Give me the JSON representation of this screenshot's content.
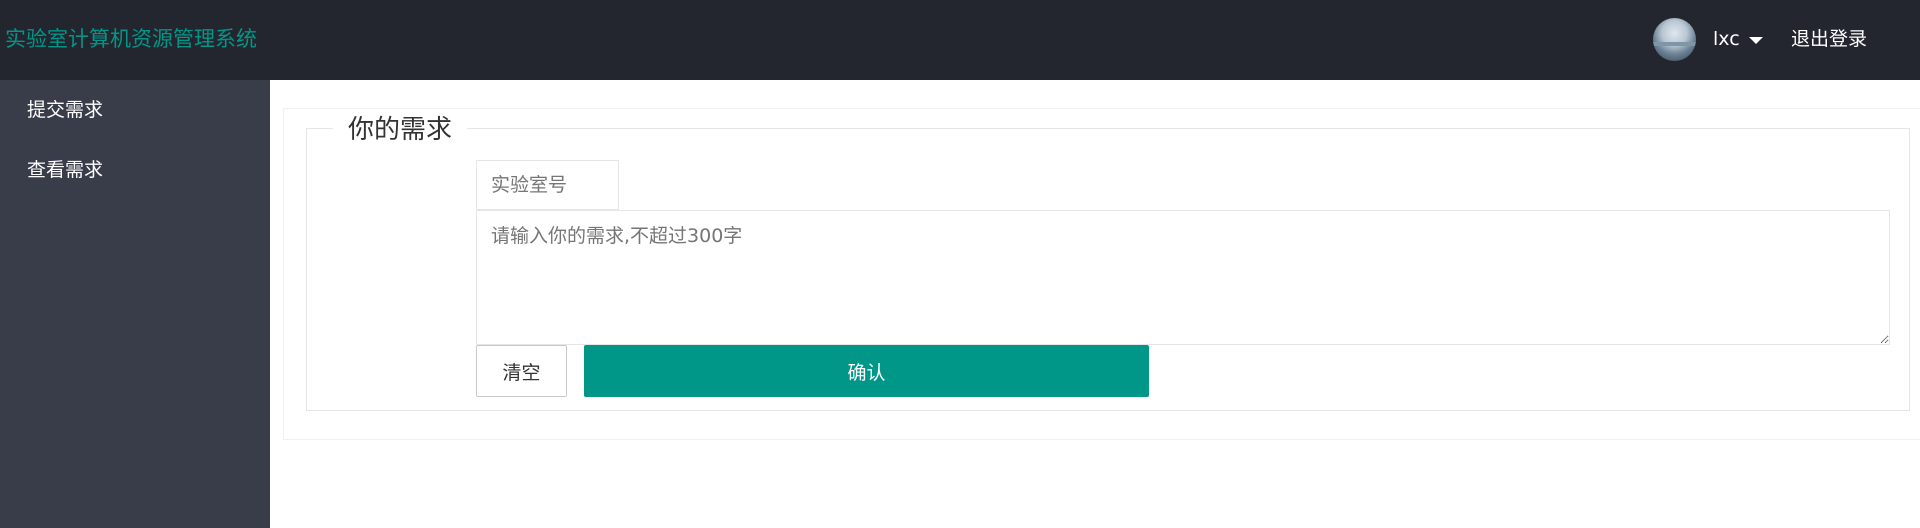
{
  "header": {
    "brand": "实验室计算机资源管理系统",
    "username": "lxc",
    "logout_label": "退出登录"
  },
  "sidebar": {
    "items": [
      {
        "label": "提交需求"
      },
      {
        "label": "查看需求"
      }
    ]
  },
  "form": {
    "legend": "你的需求",
    "room_placeholder": "实验室号",
    "room_value": "",
    "request_placeholder": "请输入你的需求,不超过300字",
    "request_value": "",
    "clear_label": "清空",
    "confirm_label": "确认"
  },
  "colors": {
    "accent": "#009688",
    "header_bg": "#23262e",
    "sidebar_bg": "#393d49"
  }
}
